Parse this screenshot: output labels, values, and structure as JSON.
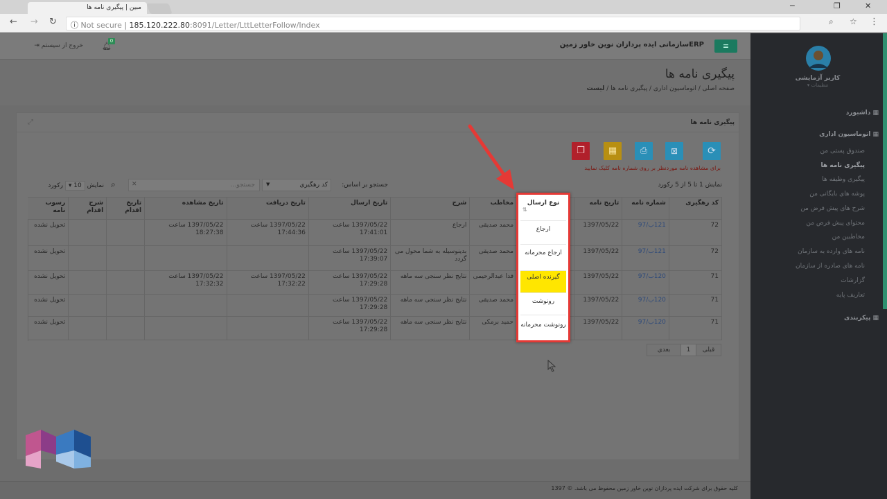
{
  "browser": {
    "tab_title": "مبین | پیگیری نامه ها",
    "not_secure": "Not secure",
    "url_host": "185.120.222.80",
    "url_path": ":8091/Letter/LttLetterFollow/Index"
  },
  "topnav": {
    "brand": "ERPسازمانی ایده پردازان نوین خاور زمین",
    "logout": "خروج از سیستم",
    "notif_count": "0"
  },
  "header": {
    "title": "پیگیری نامه ها",
    "breadcrumb": [
      "صفحه اصلی",
      "اتوماسیون اداری",
      "پیگیری نامه ها",
      "لیست"
    ]
  },
  "portlet": {
    "title": "پیگیری نامه ها",
    "hint": "برای مشاهده نامه موردنظر بر روی شماره نامه کلیک نمایید",
    "info": "نمایش 1 تا 5 از 5 رکورد",
    "search_label": "جستجو بر اساس:",
    "search_by": "کد رهگیری",
    "search_placeholder": "جستجو...",
    "show_label": "نمایش",
    "show_count": "10",
    "records_label": "رکورد"
  },
  "table": {
    "headers": [
      "کد رهگیری",
      "شماره نامه",
      "تاریخ نامه",
      "نوع ارسال",
      "مخاطب",
      "شرح",
      "تاریخ ارسال",
      "تاریخ دریافت",
      "تاریخ مشاهده",
      "تاریخ اقدام",
      "شرح اقدام",
      "رسوب نامه"
    ],
    "rows": [
      [
        "72",
        "121ب/97",
        "1397/05/22",
        "",
        "محمد صدیقی",
        "ارجاع",
        "1397/05/22 ساعت 17:41:01",
        "1397/05/22 ساعت 17:44:36",
        "1397/05/22 ساعت 18:27:38",
        "",
        "",
        "تحویل نشده"
      ],
      [
        "72",
        "121ب/97",
        "1397/05/22",
        "",
        "محمد صدیقی",
        "بدینوسیله به شما محول می گردد",
        "1397/05/22 ساعت 17:39:07",
        "",
        "",
        "",
        "",
        "تحویل نشده"
      ],
      [
        "71",
        "120ب/97",
        "1397/05/22",
        "",
        "فدا عبدالرحیمی",
        "نتایج نظر سنجی سه ماهه",
        "1397/05/22 ساعت 17:29:28",
        "1397/05/22 ساعت 17:32:22",
        "1397/05/22 ساعت 17:32:32",
        "",
        "",
        "تحویل نشده"
      ],
      [
        "71",
        "120ب/97",
        "1397/05/22",
        "",
        "محمد صدیقی",
        "نتایج نظر سنجی سه ماهه",
        "1397/05/22 ساعت 17:29:28",
        "",
        "",
        "",
        "",
        "تحویل نشده"
      ],
      [
        "71",
        "120ب/97",
        "1397/05/22",
        "",
        "حمید برمکی",
        "نتایج نظر سنجی سه ماهه",
        "1397/05/22 ساعت 17:29:28",
        "",
        "",
        "",
        "",
        "تحویل نشده"
      ]
    ]
  },
  "popup": {
    "header": "نوع ارسال",
    "items": [
      "ارجاع",
      "ارجاع محرمانه",
      "گیرنده اصلی",
      "رونوشت",
      "رونوشت محرمانه"
    ],
    "highlight_color": "#ffe600",
    "border_color": "#e53935"
  },
  "pagination": {
    "prev": "قبلی",
    "page": "1",
    "next": "بعدی"
  },
  "sidebar": {
    "user": "کاربر آزمایشی",
    "settings": "تنظیمات",
    "items": [
      "داشبورد",
      "اتوماسیون اداری",
      "صندوق پستی من",
      "پیگیری نامه ها",
      "پیگیری وظیفه ها",
      "پوشه های بایگانی من",
      "شرح های پیش فرض من",
      "محتوای پیش فرض من",
      "مخاطبین من",
      "نامه های وارده به سازمان",
      "نامه های صادره از سازمان",
      "گزارشات",
      "تعاریف پایه",
      "پیکربندی"
    ]
  },
  "footer": {
    "text": "کلیه حقوق برای شرکت ایده پردازان نوین خاور زمین محفوظ می باشد. © 1397"
  }
}
